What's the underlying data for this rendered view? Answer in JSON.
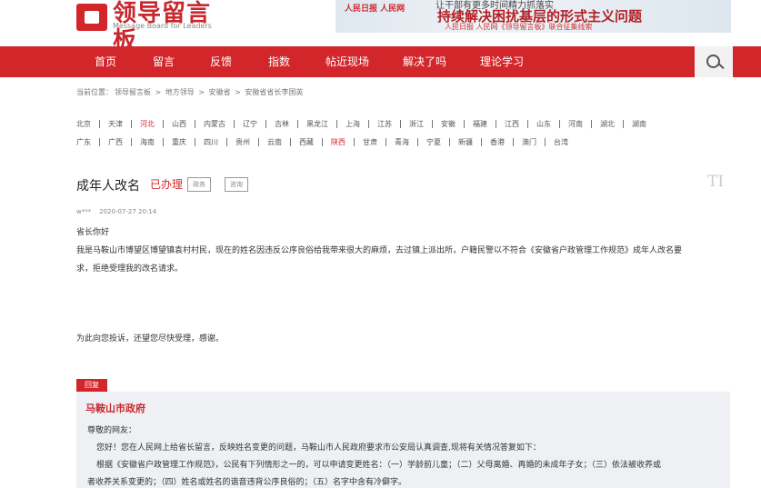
{
  "header": {
    "logo_text": "领导留言板",
    "logo_sub": "Message Board for Leaders",
    "banner": {
      "brand": "人民日报 人民网",
      "top_text": "让干部有更多时间精力抓落实",
      "title": "持续解决困扰基层的形式主义问题",
      "sub": "人民日报 人民网《领导留言板》联合征集线索"
    }
  },
  "nav": {
    "items": [
      "首页",
      "留言",
      "反馈",
      "指数",
      "帖近现场",
      "解决了吗",
      "理论学习"
    ]
  },
  "breadcrumb": {
    "label": "当前位置：",
    "items": [
      "领导留言板",
      "地方领导",
      "安徽省",
      "安徽省省长李国英"
    ],
    "sep": " > "
  },
  "provinces": {
    "row1": [
      "北京",
      "天津",
      "河北",
      "山西",
      "内蒙古",
      "辽宁",
      "吉林",
      "黑龙江",
      "上海",
      "江苏",
      "浙江",
      "安徽",
      "福建",
      "江西",
      "山东",
      "河南",
      "湖北",
      "湖南"
    ],
    "row2": [
      "广东",
      "广西",
      "海南",
      "重庆",
      "四川",
      "贵州",
      "云南",
      "西藏",
      "陕西",
      "甘肃",
      "青海",
      "宁夏",
      "新疆",
      "香港",
      "澳门",
      "台湾"
    ]
  },
  "message": {
    "title": "成年人改名",
    "status": "已办理",
    "tags": [
      "政务",
      "咨询"
    ],
    "watermark": "TI",
    "author": "w***",
    "date": "2020-07-27 20:14",
    "greeting": "省长你好",
    "line1": "我是马鞍山市博望区博望镇袁村村民，现在的姓名因违反公序良俗给我带来很大的麻烦，去过镇上派出所，户籍民警以不符合《安徽省户政管理工作规范》成年人改名要",
    "line2": "求，拒绝受理我的改名请求。",
    "line3": "为此向您投诉，还望您尽快受理，感谢。"
  },
  "reply": {
    "label": "回复",
    "org": "马鞍山市政府",
    "salutation": "尊敬的网友：",
    "p1": "您好！您在人民网上给省长留言，反映姓名变更的问题，马鞍山市人民政府要求市公安局认真调查,现将有关情况答复如下：",
    "p2": "根据《安徽省户政管理工作规范》，公民有下列情形之一的，可以申请变更姓名：（一）学龄前儿童；（二）父母离婚、再婚的未成年子女；（三）依法被收养或",
    "p3": "者收养关系变更的；（四）姓名或姓名的谐音违背公序良俗的；（五）名字中含有冷僻字。"
  }
}
